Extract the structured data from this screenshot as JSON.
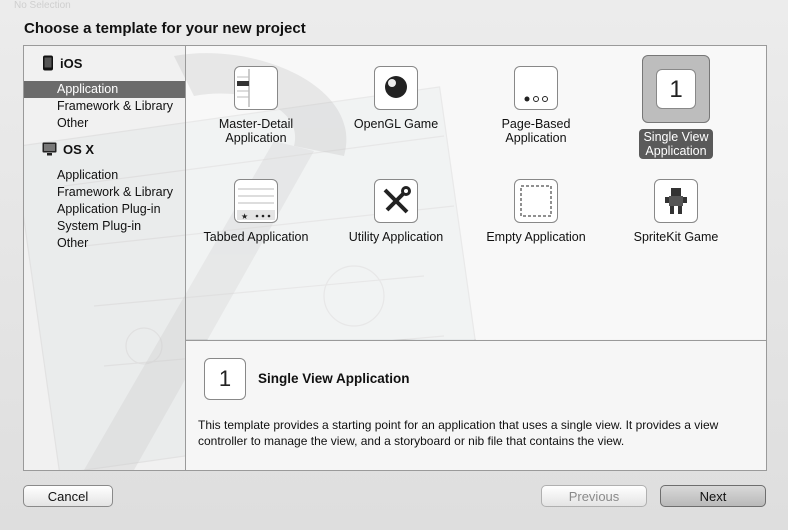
{
  "window": {
    "ghost_title": "No Selection",
    "heading": "Choose a template for your new project"
  },
  "sidebar": {
    "ios_label": "iOS",
    "ios_items": [
      "Application",
      "Framework & Library",
      "Other"
    ],
    "osx_label": "OS X",
    "osx_items": [
      "Application",
      "Framework & Library",
      "Application Plug-in",
      "System Plug-in",
      "Other"
    ],
    "selected": "Application"
  },
  "templates": [
    {
      "label": "Master-Detail\nApplication",
      "icon": "master-detail-icon"
    },
    {
      "label": "OpenGL Game",
      "icon": "opengl-icon"
    },
    {
      "label": "Page-Based\nApplication",
      "icon": "page-based-icon"
    },
    {
      "label": "Single View\nApplication",
      "icon": "single-view-icon",
      "glyph": "1",
      "selected": true
    },
    {
      "label": "Tabbed Application",
      "icon": "tabbed-icon"
    },
    {
      "label": "Utility Application",
      "icon": "utility-icon"
    },
    {
      "label": "Empty Application",
      "icon": "empty-icon"
    },
    {
      "label": "SpriteKit Game",
      "icon": "spritekit-icon"
    }
  ],
  "detail": {
    "glyph": "1",
    "title": "Single View Application",
    "description": "This template provides a starting point for an application that uses a single view. It provides a view controller to manage the view, and a storyboard or nib file that contains the view."
  },
  "buttons": {
    "cancel": "Cancel",
    "previous": "Previous",
    "next": "Next"
  },
  "colors": {
    "selection": "#6b6b6b",
    "window_bg": "#e6e6e6"
  }
}
